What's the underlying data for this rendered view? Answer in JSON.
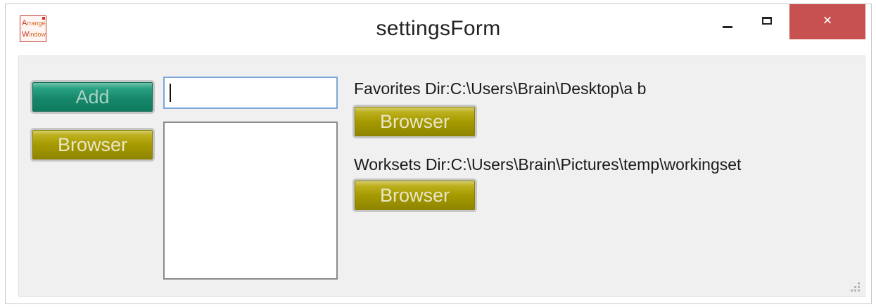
{
  "window": {
    "title": "settingsForm",
    "icon_text_line1_cap": "A",
    "icon_text_line1": "rrange",
    "icon_text_line2_cap": "W",
    "icon_text_line2": "indow",
    "minimize_glyph": "minimize",
    "maximize_glyph": "maximize",
    "close_glyph": "×"
  },
  "form": {
    "add_label": "Add",
    "browse_left_label": "Browser",
    "new_item_value": "",
    "list_items": [],
    "favorites_label": "Favorites Dir:C:\\Users\\Brain\\Desktop\\a b",
    "favorites_browse_label": "Browser",
    "worksets_label": "Worksets Dir:C:\\Users\\Brain\\Pictures\\temp\\workingset",
    "worksets_browse_label": "Browser"
  },
  "colors": {
    "close_button": "#c75050",
    "olive_button": "#a69a00",
    "green_button": "#16876a",
    "client_background": "#f0f0f0",
    "input_focus_border": "#7aa7d8"
  },
  "icons": [
    "app-icon",
    "minimize-icon",
    "maximize-icon",
    "close-icon",
    "resize-grip-icon"
  ]
}
